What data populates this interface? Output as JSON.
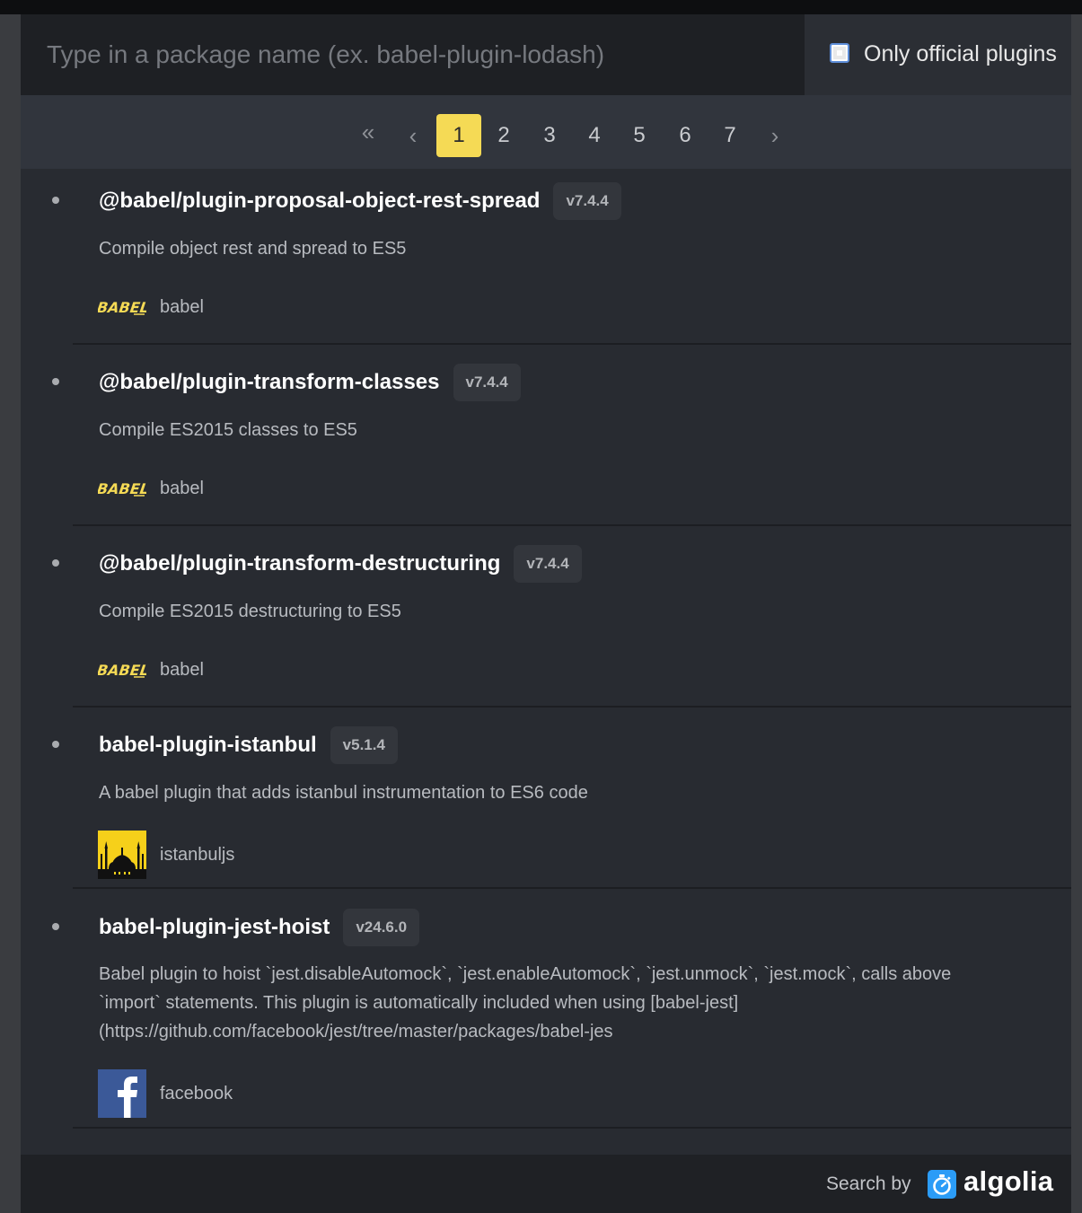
{
  "search": {
    "placeholder": "Type in a package name (ex. babel-plugin-lodash)",
    "value": ""
  },
  "filter": {
    "label": "Only official plugins",
    "checked": false
  },
  "pagination": {
    "first_icon": "double-chevron-left-icon",
    "prev_icon": "chevron-left-icon",
    "next_icon": "chevron-right-icon",
    "first_glyph": "«",
    "prev_glyph": "‹",
    "next_glyph": "›",
    "pages": [
      "1",
      "2",
      "3",
      "4",
      "5",
      "6",
      "7"
    ],
    "current": "1",
    "active_color": "#f5da55"
  },
  "results": [
    {
      "name": "@babel/plugin-proposal-object-rest-spread",
      "version": "v7.4.4",
      "description": "Compile object rest and spread to ES5",
      "owner": "babel",
      "owner_icon": "babel-logo"
    },
    {
      "name": "@babel/plugin-transform-classes",
      "version": "v7.4.4",
      "description": "Compile ES2015 classes to ES5",
      "owner": "babel",
      "owner_icon": "babel-logo"
    },
    {
      "name": "@babel/plugin-transform-destructuring",
      "version": "v7.4.4",
      "description": "Compile ES2015 destructuring to ES5",
      "owner": "babel",
      "owner_icon": "babel-logo"
    },
    {
      "name": "babel-plugin-istanbul",
      "version": "v5.1.4",
      "description": "A babel plugin that adds istanbul instrumentation to ES6 code",
      "owner": "istanbuljs",
      "owner_icon": "istanbuljs-avatar"
    },
    {
      "name": "babel-plugin-jest-hoist",
      "version": "v24.6.0",
      "description": "Babel plugin to hoist `jest.disableAutomock`, `jest.enableAutomock`, `jest.unmock`, `jest.mock`, calls above `import` statements. This plugin is automatically included when using [babel-jest](https://github.com/facebook/jest/tree/master/packages/babel-jes",
      "owner": "facebook",
      "owner_icon": "facebook-avatar"
    }
  ],
  "footer": {
    "search_by": "Search by",
    "brand": "algolia",
    "brand_icon": "algolia-stopwatch-icon",
    "brand_color": "#2b9cf7"
  }
}
